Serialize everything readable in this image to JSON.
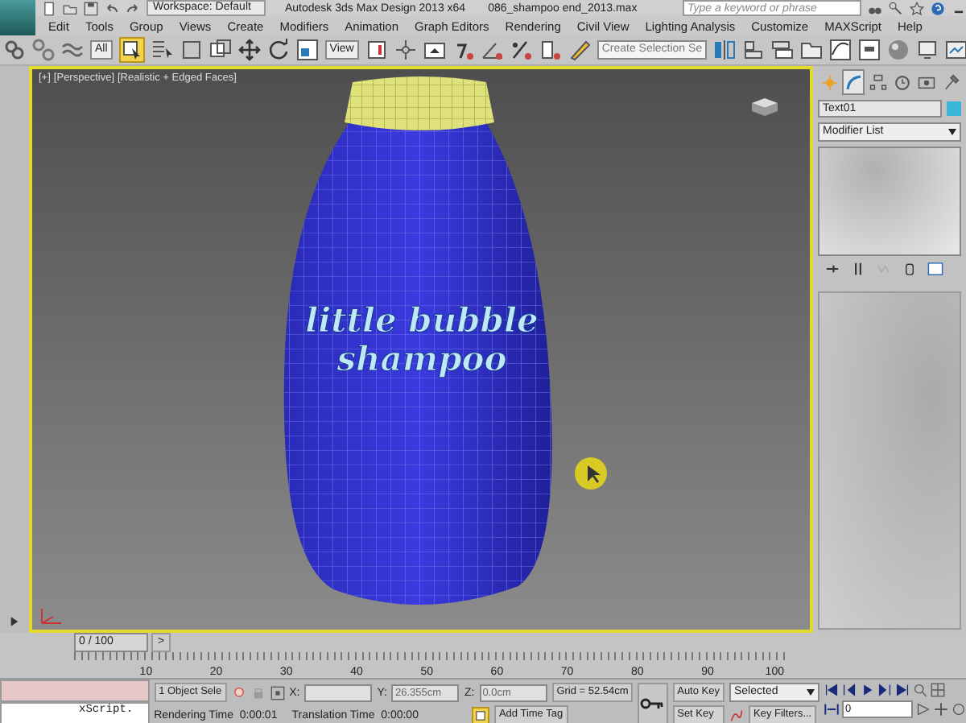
{
  "title_bar": {
    "workspace": "Workspace: Default",
    "title": "Autodesk 3ds Max Design 2013 x64",
    "file": "086_shampoo end_2013.max",
    "search_placeholder": "Type a keyword or phrase"
  },
  "menu": [
    "Edit",
    "Tools",
    "Group",
    "Views",
    "Create",
    "Modifiers",
    "Animation",
    "Graph Editors",
    "Rendering",
    "Civil View",
    "Lighting Analysis",
    "Customize",
    "MAXScript",
    "Help"
  ],
  "toolbar": {
    "selection_filter": "All",
    "reference_coordinates": "View",
    "named_selection_placeholder": "Create Selection Se"
  },
  "viewport": {
    "labels": [
      "[+]",
      "[Perspective]",
      "[Realistic + Edged Faces]"
    ],
    "scene_text": [
      "little bubble",
      "shampoo"
    ]
  },
  "command_panel": {
    "tabs": [
      {
        "selected": false
      },
      {
        "selected": true
      },
      {
        "selected": false
      },
      {
        "selected": false
      },
      {
        "selected": false
      },
      {
        "selected": false
      }
    ],
    "object_name": "Text01",
    "modifier_list": "Modifier List"
  },
  "time_slider": {
    "position": "0 / 100",
    "next": ">",
    "ticks": [
      "10",
      "20",
      "30",
      "40",
      "50",
      "60",
      "70",
      "80",
      "90",
      "100"
    ]
  },
  "status": {
    "listener_output": "xScript.",
    "selection": "1 Object Sele",
    "x_label": "X:",
    "y_label": "Y:",
    "y_value": "26.355cm",
    "z_label": "Z:",
    "z_value": "0.0cm",
    "grid": "Grid = 52.54cm",
    "rendering_time": "Rendering Time  0:00:01",
    "translation_time": "Translation Time  0:00:00",
    "add_time_tag": "Add Time Tag"
  },
  "animation": {
    "auto_key": "Auto Key",
    "set_key": "Set Key",
    "key_mode": "Selected",
    "key_filters": "Key Filters...",
    "frame": "0"
  }
}
